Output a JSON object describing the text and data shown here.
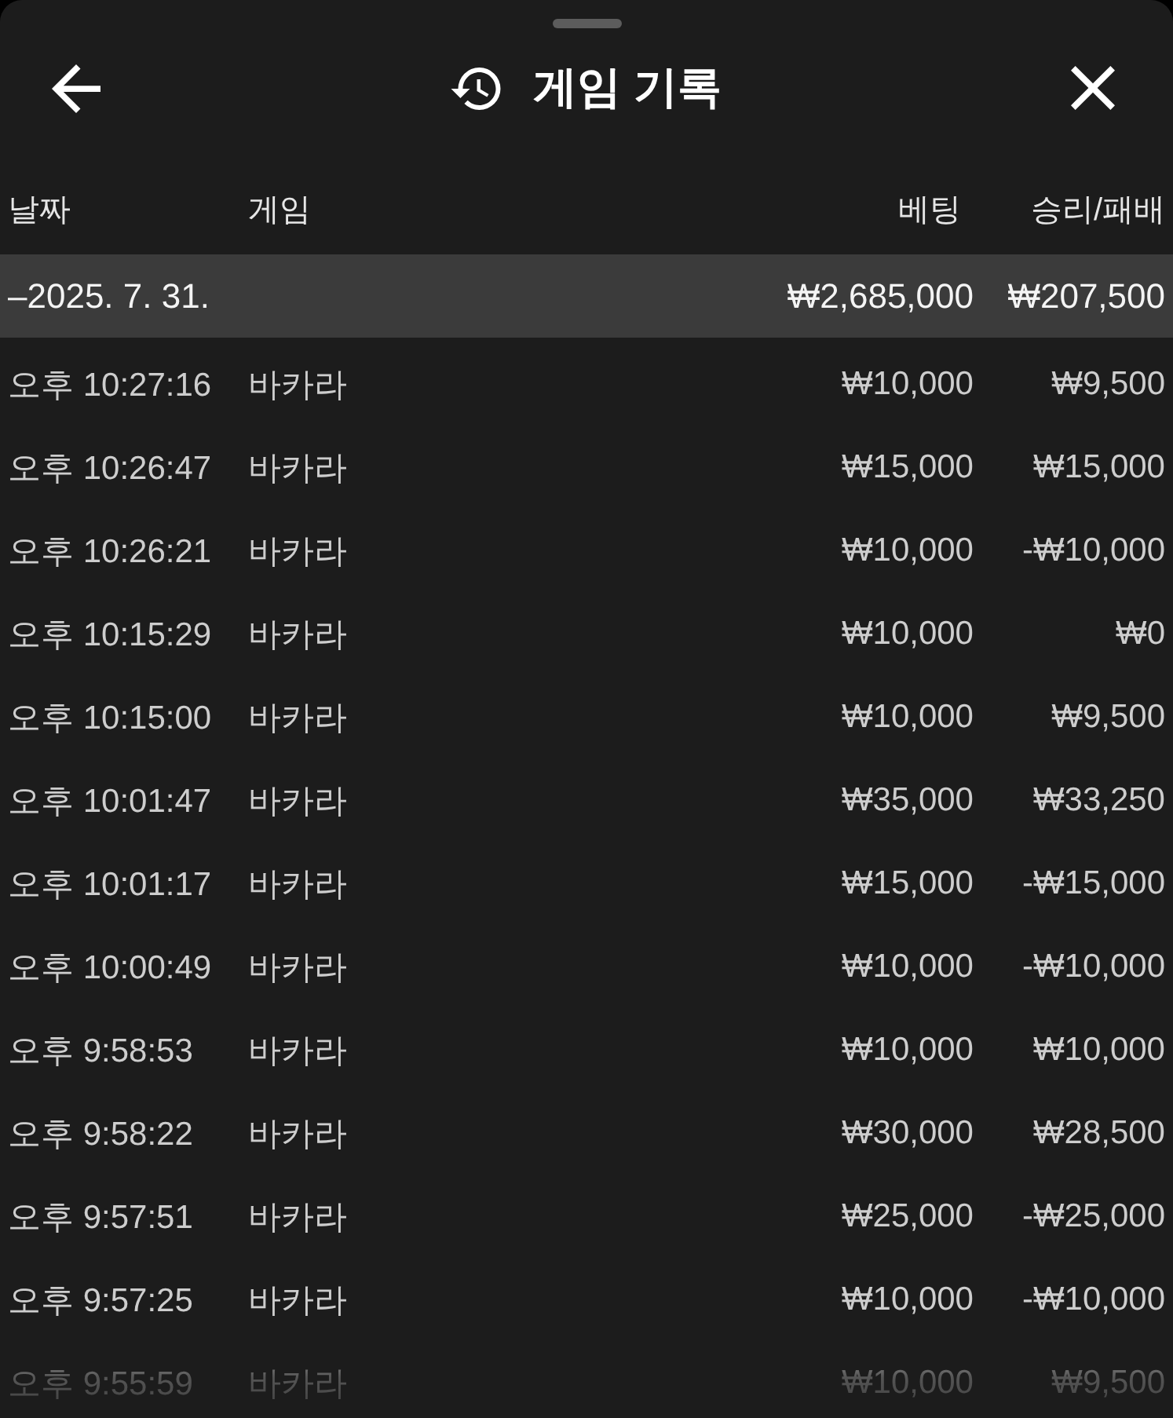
{
  "sheet": {
    "title": "게임 기록"
  },
  "table": {
    "columns": [
      "날짜",
      "게임",
      "베팅",
      "승리/패배"
    ],
    "groups": [
      {
        "label": "–2025. 7. 31.",
        "bet": "₩2,685,000",
        "result": "₩207,500",
        "rows": [
          {
            "time": "오후 10:27:16",
            "game": "바카라",
            "bet": "₩10,000",
            "result": "₩9,500"
          },
          {
            "time": "오후 10:26:47",
            "game": "바카라",
            "bet": "₩15,000",
            "result": "₩15,000"
          },
          {
            "time": "오후 10:26:21",
            "game": "바카라",
            "bet": "₩10,000",
            "result": "-₩10,000"
          },
          {
            "time": "오후 10:15:29",
            "game": "바카라",
            "bet": "₩10,000",
            "result": "₩0"
          },
          {
            "time": "오후 10:15:00",
            "game": "바카라",
            "bet": "₩10,000",
            "result": "₩9,500"
          },
          {
            "time": "오후 10:01:47",
            "game": "바카라",
            "bet": "₩35,000",
            "result": "₩33,250"
          },
          {
            "time": "오후 10:01:17",
            "game": "바카라",
            "bet": "₩15,000",
            "result": "-₩15,000"
          },
          {
            "time": "오후 10:00:49",
            "game": "바카라",
            "bet": "₩10,000",
            "result": "-₩10,000"
          },
          {
            "time": "오후 9:58:53",
            "game": "바카라",
            "bet": "₩10,000",
            "result": "₩10,000"
          },
          {
            "time": "오후 9:58:22",
            "game": "바카라",
            "bet": "₩30,000",
            "result": "₩28,500"
          },
          {
            "time": "오후 9:57:51",
            "game": "바카라",
            "bet": "₩25,000",
            "result": "-₩25,000"
          },
          {
            "time": "오후 9:57:25",
            "game": "바카라",
            "bet": "₩10,000",
            "result": "-₩10,000"
          },
          {
            "time": "오후 9:55:59",
            "game": "바카라",
            "bet": "₩10,000",
            "result": "₩9,500"
          }
        ]
      }
    ]
  }
}
